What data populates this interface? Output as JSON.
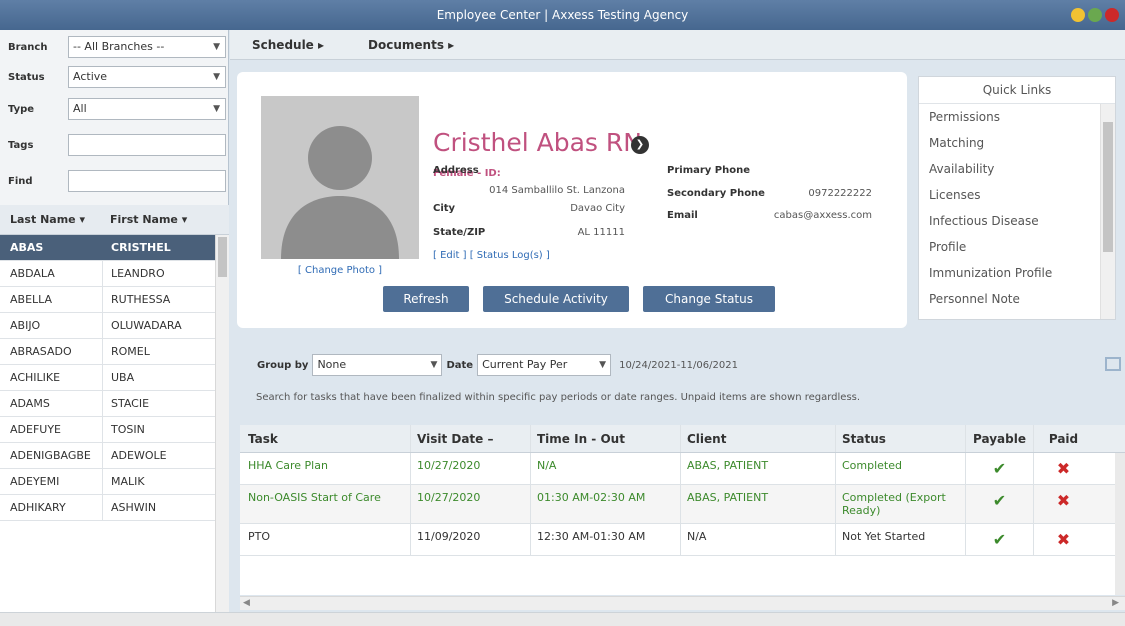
{
  "window": {
    "title": "Employee Center | Axxess Testing Agency"
  },
  "filters": {
    "branch_label": "Branch",
    "branch_value": "-- All Branches --",
    "status_label": "Status",
    "status_value": "Active",
    "type_label": "Type",
    "type_value": "All",
    "tags_label": "Tags",
    "find_label": "Find"
  },
  "employee_list": {
    "col_last": "Last Name",
    "col_first": "First Name",
    "rows": [
      {
        "last": "ABAS",
        "first": "CRISTHEL"
      },
      {
        "last": "ABDALA",
        "first": "LEANDRO"
      },
      {
        "last": "ABELLA",
        "first": "RUTHESSA"
      },
      {
        "last": "ABIJO",
        "first": "OLUWADARA"
      },
      {
        "last": "ABRASADO",
        "first": "ROMEL"
      },
      {
        "last": "ACHILIKE",
        "first": "UBA"
      },
      {
        "last": "ADAMS",
        "first": "STACIE"
      },
      {
        "last": "ADEFUYE",
        "first": "TOSIN"
      },
      {
        "last": "ADENIGBAGBE",
        "first": "ADEWOLE"
      },
      {
        "last": "ADEYEMI",
        "first": "MALIK"
      },
      {
        "last": "ADHIKARY",
        "first": "ASHWIN"
      }
    ]
  },
  "nav": {
    "schedule": "Schedule ▸",
    "documents": "Documents ▸"
  },
  "profile": {
    "name": "Cristhel Abas RN",
    "gender_id": "Female - ID:",
    "address_label": "Address",
    "address_value": "014 Samballilo St. Lanzona",
    "city_label": "City",
    "city_value": "Davao City",
    "state_label": "State/ZIP",
    "state_value": "AL 11111",
    "primary_phone_label": "Primary Phone",
    "secondary_phone_label": "Secondary Phone",
    "secondary_phone_value": "0972222222",
    "email_label": "Email",
    "email_value": "cabas@axxess.com",
    "links": "[ Edit ] [ Status Log(s) ]",
    "change_photo": "[ Change Photo ]"
  },
  "buttons": {
    "refresh": "Refresh",
    "schedule_activity": "Schedule Activity",
    "change_status": "Change Status"
  },
  "quick_links": {
    "title": "Quick Links",
    "items": [
      "Permissions",
      "Matching",
      "Availability",
      "Licenses",
      "Infectious Disease",
      "Profile",
      "Immunization Profile",
      "Personnel Note"
    ]
  },
  "task_filter": {
    "group_by_label": "Group by",
    "group_by_value": "None",
    "date_label": "Date",
    "date_value": "Current Pay Per",
    "date_range": "10/24/2021-11/06/2021",
    "note": "Search for tasks that have been finalized within specific pay periods or date ranges. Unpaid items are shown regardless."
  },
  "tasks": {
    "headers": {
      "task": "Task",
      "visit_date": "Visit Date –",
      "time": "Time In - Out",
      "client": "Client",
      "status": "Status",
      "payable": "Payable",
      "paid": "Paid"
    },
    "rows": [
      {
        "task": "HHA Care Plan",
        "date": "10/27/2020",
        "time": "N/A",
        "client": "ABAS, PATIENT",
        "status": "Completed"
      },
      {
        "task": "Non-OASIS Start of Care",
        "date": "10/27/2020",
        "time": "01:30 AM-02:30 AM",
        "client": "ABAS, PATIENT",
        "status": "Completed (Export Ready)"
      },
      {
        "task": "PTO",
        "date": "11/09/2020",
        "time": "12:30 AM-01:30 AM",
        "client": "N/A",
        "status": "Not Yet Started"
      }
    ]
  },
  "colors": {
    "titlebar": "#4f6f96",
    "accent_name": "#c0517f",
    "button": "#4f6f96",
    "completed_green": "#3c8a2c",
    "x_red": "#cc2929"
  },
  "icons": {
    "payable": "check-icon",
    "paid": "x-icon"
  }
}
